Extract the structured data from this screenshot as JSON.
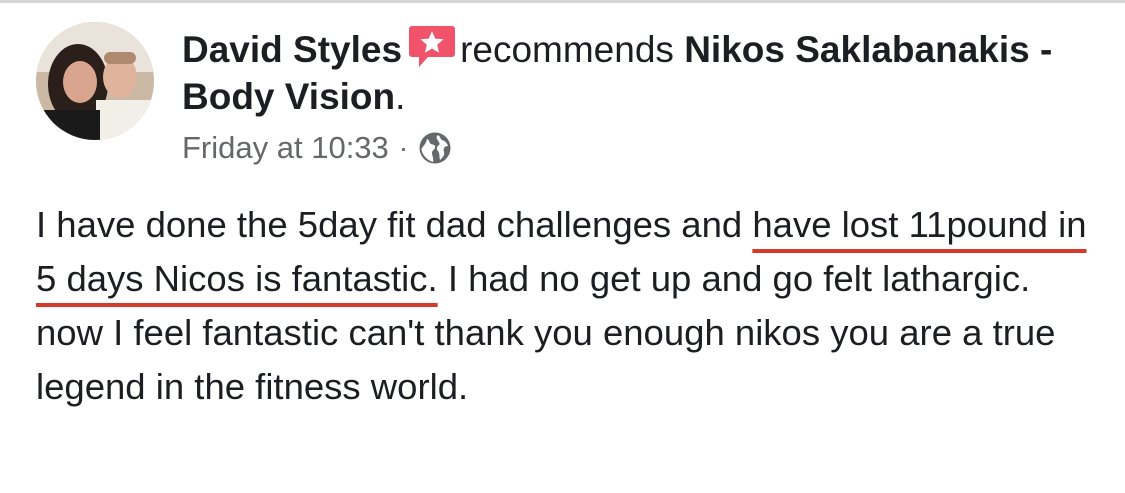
{
  "post": {
    "author": "David Styles",
    "verb": "recommends",
    "page_name": "Nikos Saklabanakis - Body Vision",
    "period": ".",
    "timestamp": "Friday at 10:33",
    "separator": "·",
    "privacy_icon": "globe-icon",
    "recommend_icon": "star-speech-bubble-icon",
    "text_before": "I have done the 5day fit dad challenges and ",
    "text_highlighted": "have lost 11pound in 5 days Nicos is fantastic.",
    "text_after": " I had no get up and go felt lathargic. now I feel fantastic can't thank you enough nikos you are a true legend in the fitness world.",
    "highlight_color": "#d63a2b",
    "recommend_icon_color": "#f0536a"
  }
}
